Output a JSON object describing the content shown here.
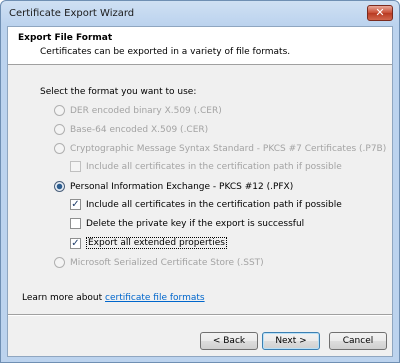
{
  "window": {
    "title": "Certificate Export Wizard",
    "close_symbol": "✕"
  },
  "header": {
    "title": "Export File Format",
    "subtitle": "Certificates can be exported in a variety of file formats."
  },
  "prompt": "Select the format you want to use:",
  "options": {
    "der": "DER encoded binary X.509 (.CER)",
    "base64": "Base-64 encoded X.509 (.CER)",
    "p7b": "Cryptographic Message Syntax Standard - PKCS #7 Certificates (.P7B)",
    "p7b_include": "Include all certificates in the certification path if possible",
    "pfx": "Personal Information Exchange - PKCS #12 (.PFX)",
    "pfx_include": "Include all certificates in the certification path if possible",
    "pfx_delete": "Delete the private key if the export is successful",
    "pfx_export": "Export all extended properties",
    "sst": "Microsoft Serialized Certificate Store (.SST)"
  },
  "state": {
    "selected_format": "pfx",
    "pfx_include_checked": true,
    "pfx_delete_checked": false,
    "pfx_export_checked": true
  },
  "learn": {
    "prefix": "Learn more about ",
    "link": "certificate file formats"
  },
  "buttons": {
    "back": "< Back",
    "next": "Next >",
    "cancel": "Cancel"
  },
  "check_symbol": "✓"
}
